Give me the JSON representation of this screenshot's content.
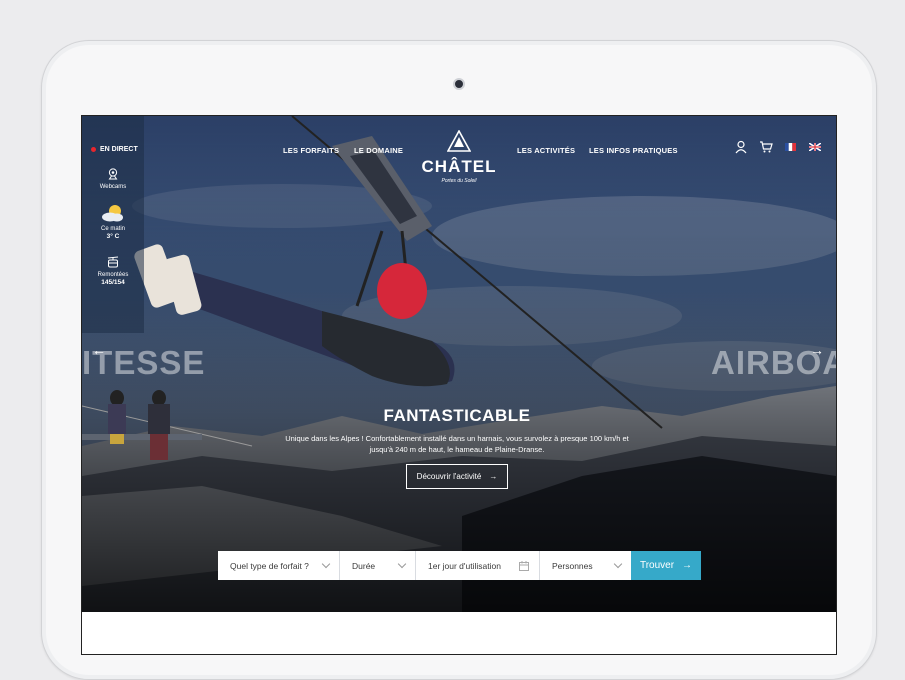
{
  "nav": {
    "links": [
      "LES FORFAITS",
      "LE DOMAINE",
      "LES ACTIVITÉS",
      "LES INFOS PRATIQUES"
    ],
    "logo": {
      "word": "CHÂTEL",
      "tagline": "Portes du Soleil"
    },
    "icons": [
      "user-icon",
      "cart-icon",
      "flag-fr-icon",
      "flag-uk-icon"
    ]
  },
  "sidebar": {
    "live": "EN DIRECT",
    "webcams": "Webcams",
    "weather_label": "Ce matin",
    "weather_temp": "3° C",
    "lifts_label": "Remontées",
    "lifts_count": "145/154"
  },
  "slider": {
    "prev_ghost": "ITESSE",
    "next_ghost": "AIRBOA",
    "title": "FANTASTICABLE",
    "text": "Unique dans les Alpes ! Confortablement installé dans un harnais, vous survolez à presque 100 km/h et jusqu'à 240 m de haut, le hameau de Plaine-Dranse.",
    "cta": "Découvrir l'activité"
  },
  "search": {
    "type": "Quel type de forfait ?",
    "duration": "Durée",
    "date": "1er jour d'utilisation",
    "persons": "Personnes",
    "button": "Trouver"
  },
  "colors": {
    "accent": "#36a9c9",
    "live_dot": "#e8262d"
  }
}
